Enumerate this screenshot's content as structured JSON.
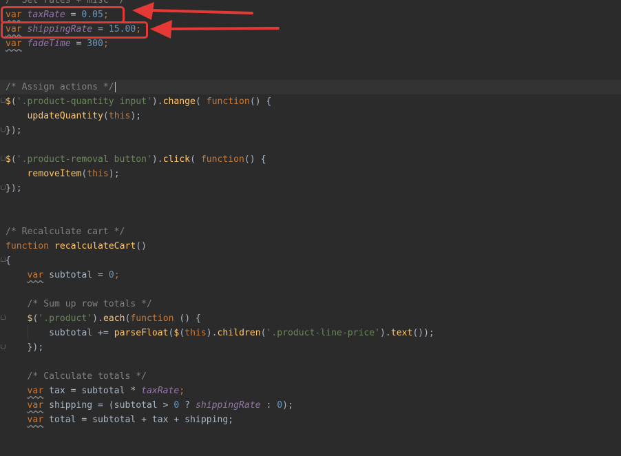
{
  "editor": {
    "lines": {
      "l0": {
        "comment": "/* Set rates + misc */"
      },
      "l1": {
        "kw": "var",
        "name": "taxRate",
        "op": " = ",
        "value": "0.05",
        "end": ";"
      },
      "l2": {
        "kw": "var",
        "name": "shippingRate",
        "op": " = ",
        "value": "15.00",
        "end": ";"
      },
      "l3": {
        "kw": "var",
        "name": "fadeTime",
        "op": " = ",
        "value": "300",
        "end": ";"
      },
      "l6": {
        "comment": "/* Assign actions */"
      },
      "l7": {
        "fn": "$",
        "p1": "(",
        "str": "'.product-quantity input'",
        "p2": ").",
        "method": "change",
        "p3": "( ",
        "kw": "function",
        "p4": "() {"
      },
      "l8": {
        "fn": "updateQuantity",
        "p1": "(",
        "th": "this",
        "p2": ");"
      },
      "l9": {
        "text": "});"
      },
      "l11": {
        "fn": "$",
        "p1": "(",
        "str": "'.product-removal button'",
        "p2": ").",
        "method": "click",
        "p3": "( ",
        "kw": "function",
        "p4": "() {"
      },
      "l12": {
        "fn": "removeItem",
        "p1": "(",
        "th": "this",
        "p2": ");"
      },
      "l13": {
        "text": "});"
      },
      "l16": {
        "comment": "/* Recalculate cart */"
      },
      "l17": {
        "kw": "function",
        "sp": " ",
        "fn": "recalculateCart",
        "p": "()"
      },
      "l18": {
        "text": "{"
      },
      "l19": {
        "kw": "var",
        "rest": " subtotal = ",
        "num": "0",
        "end": ";"
      },
      "l21": {
        "comment": "/* Sum up row totals */"
      },
      "l22": {
        "fn": "$",
        "p1": "(",
        "str": "'.product'",
        "p2": ").",
        "method": "each",
        "p3": "(",
        "kw": "function",
        "p4": " () {"
      },
      "l23": {
        "a": "subtotal += ",
        "fn1": "parseFloat",
        "b": "(",
        "fn2": "$",
        "c": "(",
        "th": "this",
        "d": ").",
        "fn3": "children",
        "e": "(",
        "str": "'.product-line-price'",
        "f": ").",
        "fn4": "text",
        "g": "());"
      },
      "l24": {
        "text": "});"
      },
      "l26": {
        "comment": "/* Calculate totals */"
      },
      "l27": {
        "kw": "var",
        "rest": " tax = subtotal * ",
        "gv": "taxRate",
        "end": ";"
      },
      "l28": {
        "kw": "var",
        "rest": " shipping = (subtotal > ",
        "num": "0",
        "q": " ? ",
        "gv": "shippingRate",
        "r": " : ",
        "num2": "0",
        "end": ");"
      },
      "l29": {
        "kw": "var",
        "rest": " total = subtotal + tax + shipping;"
      }
    }
  },
  "annotations": {
    "color": "#e53935",
    "arrow_targets": [
      "taxRate",
      "shippingRate"
    ]
  },
  "colors": {
    "background": "#2b2b2b",
    "keyword": "#cc7832",
    "global_var": "#9876aa",
    "number": "#6897bb",
    "string": "#6a8759",
    "comment": "#808080",
    "function": "#ffc66d",
    "text": "#a9b7c6"
  }
}
